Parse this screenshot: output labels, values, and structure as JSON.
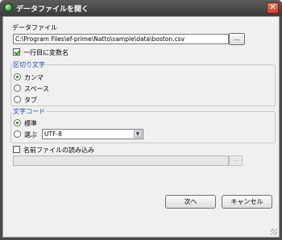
{
  "window": {
    "title": "データファイルを開く",
    "close_label": "✕"
  },
  "data_file": {
    "label": "データファイル",
    "path": "C:\\Program Files\\ef-prime\\Natto\\sample\\data\\boston.csv",
    "browse_label": "..."
  },
  "header_row": {
    "label": "一行目に変数名",
    "checked": true
  },
  "delimiter": {
    "legend": "区切り文字",
    "options": [
      {
        "label": "カンマ",
        "selected": true
      },
      {
        "label": "スペース",
        "selected": false
      },
      {
        "label": "タブ",
        "selected": false
      }
    ]
  },
  "encoding": {
    "legend": "文字コード",
    "options": [
      {
        "label": "標準",
        "selected": true
      },
      {
        "label": "選ぶ",
        "selected": false
      }
    ],
    "select_value": "UTF-8"
  },
  "name_file": {
    "label": "名前ファイルの読み込み",
    "checked": false,
    "path": "",
    "browse_label": "..."
  },
  "buttons": {
    "next": "次へ",
    "cancel": "キャンセル"
  },
  "colors": {
    "titlebar": "#4a4a4a",
    "legend_text": "#1a4fb0",
    "check_mark": "#2b8a1a"
  }
}
